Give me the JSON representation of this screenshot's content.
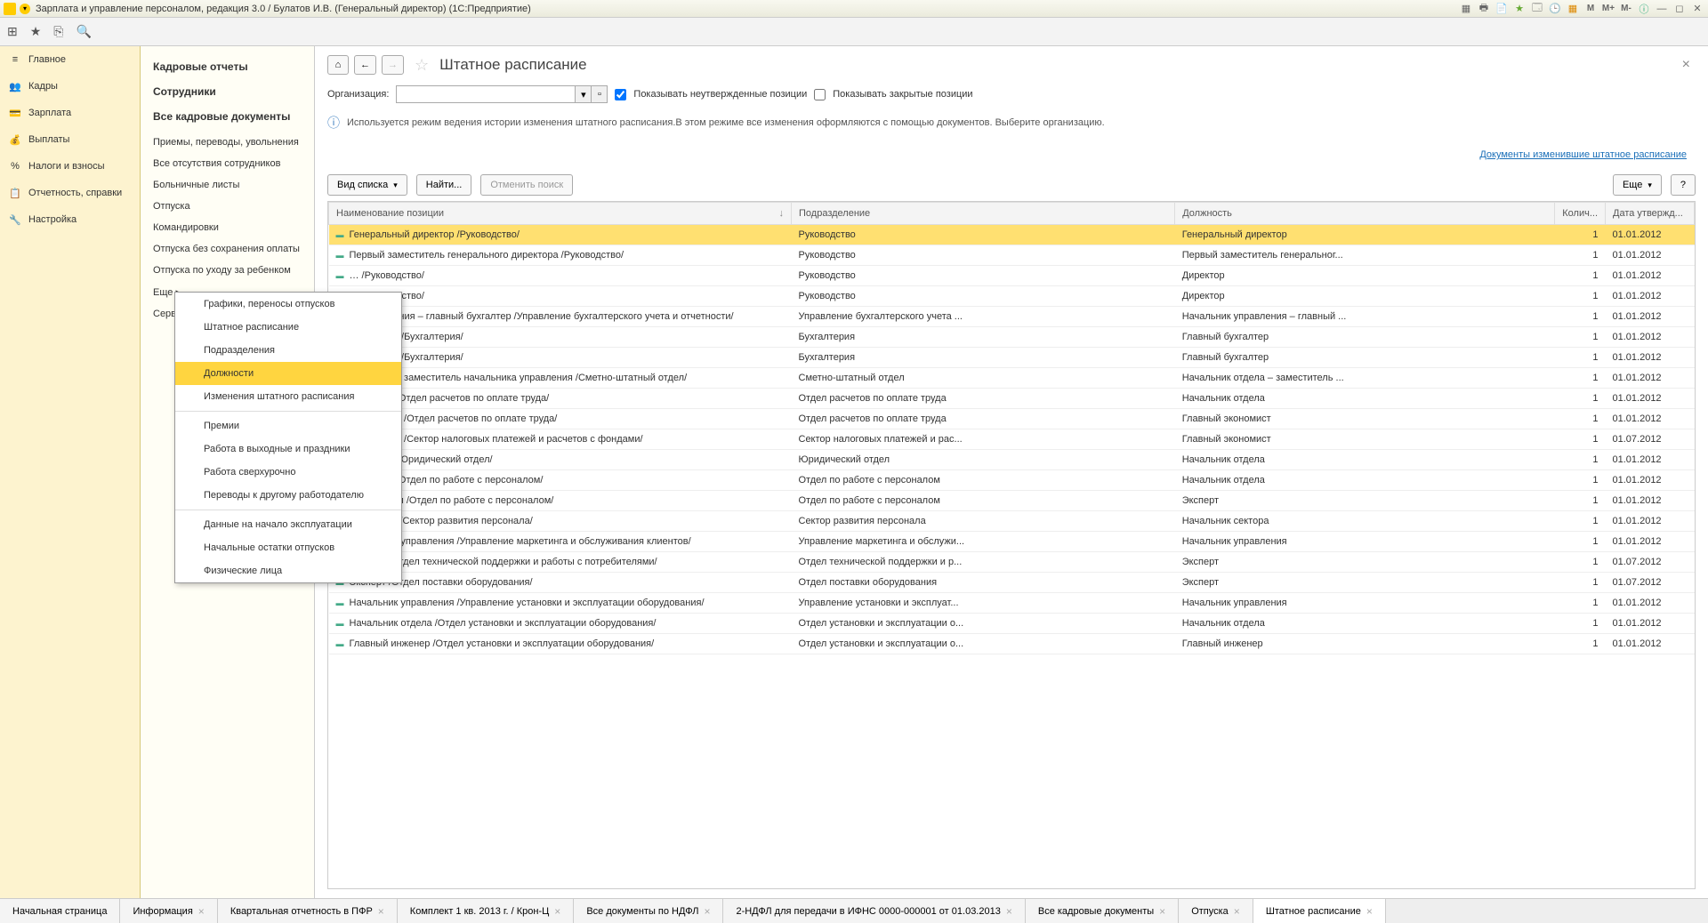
{
  "window_title": "Зарплата и управление персоналом, редакция 3.0 / Булатов И.В. (Генеральный директор)  (1С:Предприятие)",
  "nav": [
    {
      "icon": "≡",
      "label": "Главное"
    },
    {
      "icon": "👥",
      "label": "Кадры"
    },
    {
      "icon": "💳",
      "label": "Зарплата"
    },
    {
      "icon": "💰",
      "label": "Выплаты"
    },
    {
      "icon": "%",
      "label": "Налоги и взносы"
    },
    {
      "icon": "📋",
      "label": "Отчетность, справки"
    },
    {
      "icon": "🔧",
      "label": "Настройка"
    }
  ],
  "subnav": {
    "h1": "Кадровые отчеты",
    "h2": "Сотрудники",
    "h3": "Все кадровые документы",
    "items": [
      "Приемы, переводы, увольнения",
      "Все отсутствия сотрудников",
      "Больничные листы",
      "Отпуска",
      "Командировки",
      "Отпуска без сохранения оплаты",
      "Отпуска по уходу за ребенком"
    ],
    "more": "Еще ▸",
    "serv": "Серв…"
  },
  "popup": [
    "Графики, переносы отпусков",
    "Штатное расписание",
    "Подразделения",
    "Должности",
    "Изменения штатного расписания",
    "Премии",
    "Работа в выходные и праздники",
    "Работа сверхурочно",
    "Переводы к другому работодателю",
    "Данные на начало эксплуатации",
    "Начальные остатки отпусков",
    "Физические лица"
  ],
  "page": {
    "title": "Штатное расписание",
    "org_label": "Организация:",
    "chk1": "Показывать неутвержденные позиции",
    "chk2": "Показывать закрытые позиции",
    "info": "Используется режим ведения истории изменения штатного расписания.В этом режиме все изменения оформляются с помощью документов. Выберите организацию.",
    "link": "Документы изменившие штатное расписание",
    "btn_view": "Вид списка",
    "btn_find": "Найти...",
    "btn_cancel": "Отменить поиск",
    "btn_more": "Еще",
    "cols": [
      "Наименование позиции",
      "Подразделение",
      "Должность",
      "Колич...",
      "Дата утвержд..."
    ]
  },
  "rows": [
    {
      "name": "Генеральный директор /Руководство/",
      "dept": "Руководство",
      "pos": "Генеральный директор",
      "qty": "1",
      "date": "01.01.2012",
      "sel": true
    },
    {
      "name": "Первый заместитель генерального директора /Руководство/",
      "dept": "Руководство",
      "pos": "Первый заместитель генеральног...",
      "qty": "1",
      "date": "01.01.2012"
    },
    {
      "name": "… /Руководство/",
      "dept": "Руководство",
      "pos": "Директор",
      "qty": "1",
      "date": "01.01.2012"
    },
    {
      "name": "… /Руководство/",
      "dept": "Руководство",
      "pos": "Директор",
      "qty": "1",
      "date": "01.01.2012"
    },
    {
      "name": "… управления – главный бухгалтер /Управление бухгалтерского учета и отчетности/",
      "dept": "Управление бухгалтерского учета ...",
      "pos": "Начальник управления – главный ...",
      "qty": "1",
      "date": "01.01.2012"
    },
    {
      "name": "…ухгалтер /Бухгалтерия/",
      "dept": "Бухгалтерия",
      "pos": "Главный бухгалтер",
      "qty": "1",
      "date": "01.01.2012"
    },
    {
      "name": "…ухгалтер /Бухгалтерия/",
      "dept": "Бухгалтерия",
      "pos": "Главный бухгалтер",
      "qty": "1",
      "date": "01.01.2012"
    },
    {
      "name": "… отдела – заместитель начальника управления /Сметно-штатный отдел/",
      "dept": "Сметно-штатный отдел",
      "pos": "Начальник отдела – заместитель ...",
      "qty": "1",
      "date": "01.01.2012"
    },
    {
      "name": "… отдела /Отдел расчетов по оплате труда/",
      "dept": "Отдел расчетов по оплате труда",
      "pos": "Начальник отдела",
      "qty": "1",
      "date": "01.01.2012"
    },
    {
      "name": "…кономист /Отдел расчетов по оплате труда/",
      "dept": "Отдел расчетов по оплате труда",
      "pos": "Главный экономист",
      "qty": "1",
      "date": "01.01.2012"
    },
    {
      "name": "…кономист /Сектор налоговых платежей и расчетов с фондами/",
      "dept": "Сектор налоговых платежей и рас...",
      "pos": "Главный экономист",
      "qty": "1",
      "date": "01.07.2012"
    },
    {
      "name": "… отдела /Юридический отдел/",
      "dept": "Юридический отдел",
      "pos": "Начальник отдела",
      "qty": "1",
      "date": "01.01.2012"
    },
    {
      "name": "… отдела /Отдел по работе с персоналом/",
      "dept": "Отдел по работе с персоналом",
      "pos": "Начальник отдела",
      "qty": "1",
      "date": "01.01.2012"
    },
    {
      "name": "…категории /Отдел по работе с персоналом/",
      "dept": "Отдел по работе с персоналом",
      "pos": "Эксперт",
      "qty": "1",
      "date": "01.01.2012"
    },
    {
      "name": "… сектора /Сектор развития персонала/",
      "dept": "Сектор развития персонала",
      "pos": "Начальник сектора",
      "qty": "1",
      "date": "01.01.2012"
    },
    {
      "name": "Начальник управления /Управление маркетинга и обслуживания клиентов/",
      "dept": "Управление маркетинга и обслужи...",
      "pos": "Начальник управления",
      "qty": "1",
      "date": "01.01.2012"
    },
    {
      "name": "Эксперт /Отдел технической поддержки и работы с потребителями/",
      "dept": "Отдел технической поддержки и р...",
      "pos": "Эксперт",
      "qty": "1",
      "date": "01.07.2012"
    },
    {
      "name": "Эксперт /Отдел поставки оборудования/",
      "dept": "Отдел поставки оборудования",
      "pos": "Эксперт",
      "qty": "1",
      "date": "01.07.2012"
    },
    {
      "name": "Начальник управления /Управление установки и эксплуатации оборудования/",
      "dept": "Управление установки и эксплуат...",
      "pos": "Начальник управления",
      "qty": "1",
      "date": "01.01.2012"
    },
    {
      "name": "Начальник отдела /Отдел установки и эксплуатации оборудования/",
      "dept": "Отдел установки и эксплуатации о...",
      "pos": "Начальник отдела",
      "qty": "1",
      "date": "01.01.2012"
    },
    {
      "name": "Главный инженер /Отдел установки и эксплуатации оборудования/",
      "dept": "Отдел установки и эксплуатации о...",
      "pos": "Главный инженер",
      "qty": "1",
      "date": "01.01.2012"
    }
  ],
  "tabs": [
    "Начальная страница",
    "Информация",
    "Квартальная отчетность в ПФР",
    "Комплект 1 кв. 2013 г. / Крон-Ц",
    "Все документы по НДФЛ",
    "2-НДФЛ для передачи в ИФНС 0000-000001 от 01.03.2013",
    "Все кадровые документы",
    "Отпуска",
    "Штатное расписание"
  ]
}
